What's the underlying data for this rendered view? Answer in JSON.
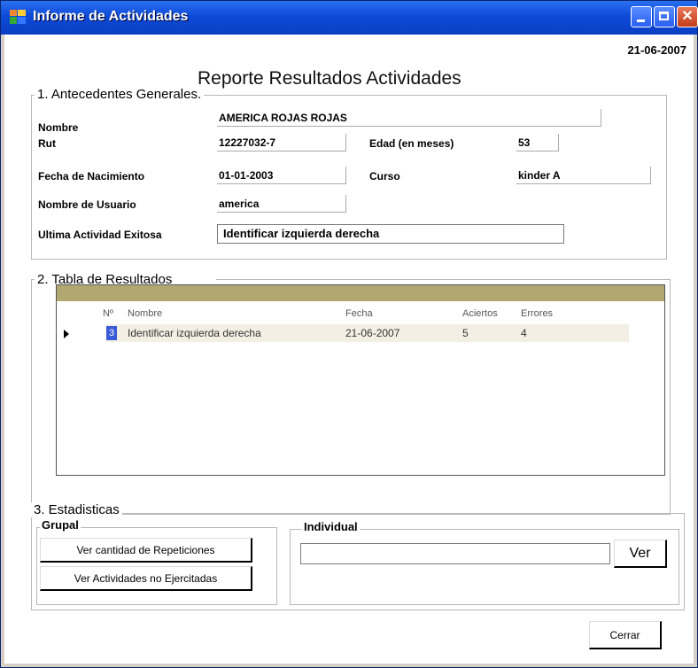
{
  "window": {
    "title": "Informe de Actividades"
  },
  "header": {
    "date": "21-06-2007",
    "report_title": "Reporte Resultados Actividades"
  },
  "antecedentes": {
    "section_label": "1. Antecedentes Generales.",
    "nombre_label": "Nombre",
    "nombre_value": "AMERICA ROJAS ROJAS",
    "rut_label": "Rut",
    "rut_value": "12227032-7",
    "edad_label": "Edad (en meses)",
    "edad_value": "53",
    "fecha_nac_label": "Fecha de Nacimiento",
    "fecha_nac_value": "01-01-2003",
    "curso_label": "Curso",
    "curso_value": "kinder A",
    "usuario_label": "Nombre de Usuario",
    "usuario_value": "america",
    "ultima_label": "Ultima Actividad Exitosa",
    "ultima_value": "Identificar izquierda derecha"
  },
  "resultados": {
    "section_label": "2. Tabla de Resultados",
    "columns": [
      "Nº",
      "Nombre",
      "Fecha",
      "Aciertos",
      "Errores"
    ],
    "rows": [
      {
        "num": "3",
        "nombre": "Identificar izquierda derecha",
        "fecha": "21-06-2007",
        "aciertos": "5",
        "errores": "4"
      }
    ]
  },
  "estadisticas": {
    "section_label": "3. Estadisticas",
    "grupal_label": "Grupal",
    "btn_repeticiones": "Ver cantidad de Repeticiones",
    "btn_no_ejercitadas": "Ver Actividades no Ejercitadas",
    "individual_label": "Individual",
    "individual_value": "",
    "btn_ver": "Ver"
  },
  "footer": {
    "btn_cerrar": "Cerrar"
  }
}
